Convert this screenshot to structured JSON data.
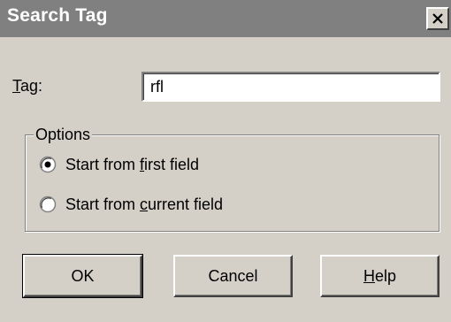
{
  "window": {
    "title": "Search Tag",
    "close_icon": "close-x-icon"
  },
  "tag": {
    "label_mnemonic": "T",
    "label_rest": "ag:",
    "value": "rfl"
  },
  "options": {
    "legend": "Options",
    "radio_first": {
      "pre": "Start from ",
      "mnemonic": "f",
      "post": "irst field",
      "checked": true
    },
    "radio_current": {
      "pre": "Start from ",
      "mnemonic": "c",
      "post": "urrent field",
      "checked": false
    }
  },
  "buttons": {
    "ok": "OK",
    "cancel": "Cancel",
    "help_mnemonic": "H",
    "help_rest": "elp"
  }
}
